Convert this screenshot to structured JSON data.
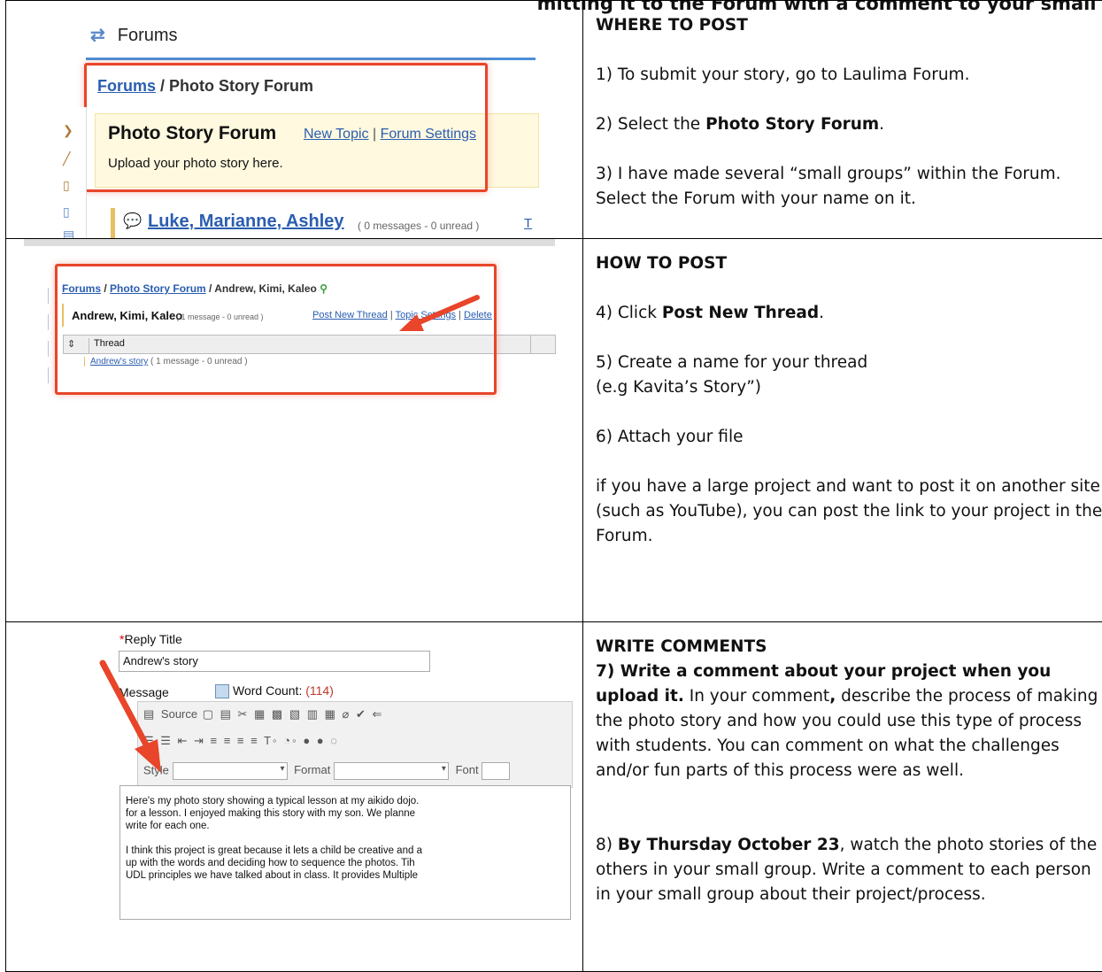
{
  "document": {
    "header_partial": "today's assignment: making a photo story and submitting it to the Forum with a comment to your small group"
  },
  "rows": [
    {
      "screenshot": {
        "forums_header": "Forums",
        "forums_icon": "refresh-icon",
        "breadcrumb_link": "Forums",
        "breadcrumb_rest": " / Photo Story Forum",
        "forum_title": "Photo Story Forum",
        "new_topic_link": "New Topic",
        "separator": " | ",
        "forum_settings_link": "Forum Settings",
        "forum_description": "Upload your photo story here.",
        "topic_title": "Luke, Marianne, Ashley",
        "topic_meta": "( 0 messages - 0 unread )",
        "topic_more": "T"
      },
      "heading": "WHERE TO POST",
      "step1": "1) To submit your story, go to Laulima Forum.",
      "step2_pre": "2) Select the ",
      "step2_bold": "Photo Story Forum",
      "step2_post": ".",
      "step3": "3) I have made several “small groups” within the Forum. Select the Forum with your name on it."
    },
    {
      "screenshot": {
        "crumb_forums": "Forums",
        "crumb_sep1": " / ",
        "crumb_forum": "Photo Story Forum",
        "crumb_rest": " / Andrew, Kimi, Kaleo",
        "topic_name": "Andrew, Kimi, Kaleo",
        "topic_meta": "( 1 message - 0 unread )",
        "post_new_thread_link": "Post New Thread",
        "topic_settings_link": "Topic Settings",
        "delete_link": "Delete",
        "thread_header": "Thread",
        "thread_link": "Andrew's story",
        "thread_meta": "( 1 message - 0 unread )"
      },
      "heading": "HOW TO POST",
      "step4_pre": "4) Click ",
      "step4_bold": "Post New Thread",
      "step4_post": ".",
      "step5_line1": "5) Create a name for your thread",
      "step5_line2": "(e.g Kavita’s Story”)",
      "step6": "6) Attach your file",
      "note": "if you have a large project and want to post it on another site (such as YouTube), you can post the link to your project in the Forum."
    },
    {
      "screenshot": {
        "reply_title_label": "Reply Title",
        "reply_title_value": "Andrew's story",
        "message_label": "Message",
        "word_count_label": "Word Count:",
        "word_count_value": "(114)",
        "source_button": "Source",
        "style_label": "Style",
        "format_label": "Format",
        "font_label": "Font",
        "body_line1": "Here's my photo story showing a typical lesson at my aikido dojo.",
        "body_line2": "for a lesson.  I enjoyed making this story with my son. We planne",
        "body_line3": "write for each one.",
        "body_line4": "I think this project is great because it lets a child be creative and a",
        "body_line5": "up with the words and deciding how to sequence the photos.  Tih",
        "body_line6": "UDL principles we have talked about in class. It provides Multiple"
      },
      "heading": "WRITE COMMENTS",
      "step7_bold": "7) Write a comment about your project when you upload it.",
      "step7_rest_a": "  In your comment",
      "step7_comma": ",",
      "step7_rest_b": " describe the process of making the photo story and how you could use this type of process with students. You can comment on what the challenges and/or fun parts of this process were as well.",
      "step8_pre": "8) ",
      "step8_bold": "By Thursday October 23",
      "step8_post": ", watch the photo stories of the others in your small group. Write a comment to each person in your small group about their project/process."
    }
  ],
  "colors": {
    "highlight_box": "#e8452a",
    "link": "#2a5db0",
    "forum_box_bg": "#fff9df"
  }
}
